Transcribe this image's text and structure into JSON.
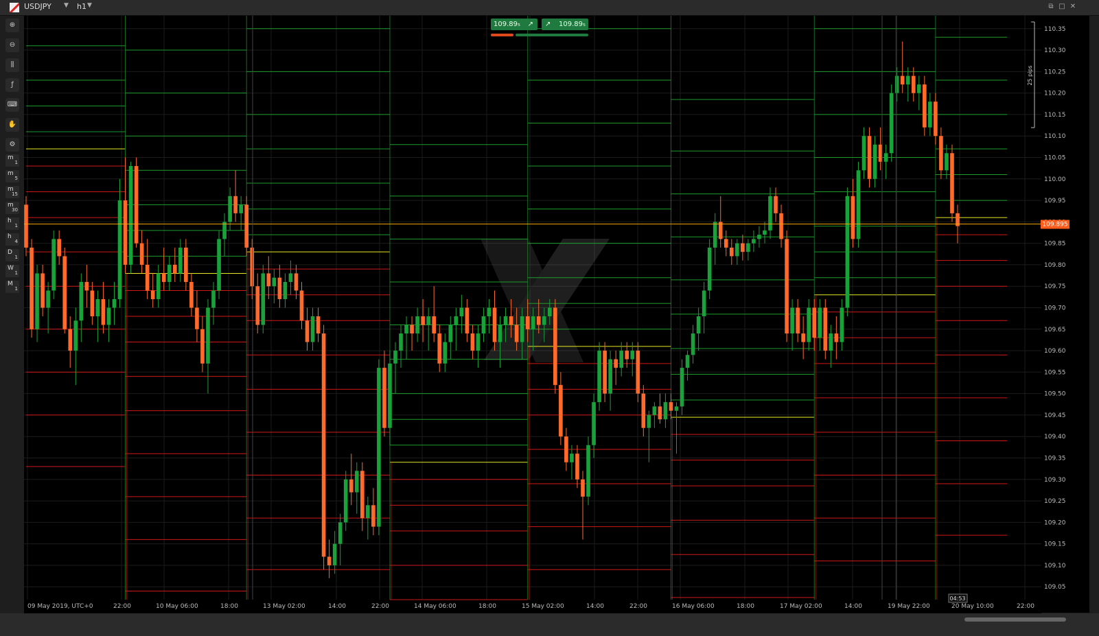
{
  "window": {
    "symbol": "USDJPY",
    "timeframe": "h1"
  },
  "toolbar": {
    "tools": [
      "zoom-in-icon",
      "zoom-out-icon",
      "candles-icon",
      "indicator-icon",
      "controller-icon",
      "hand-icon",
      "settings-icon"
    ],
    "timeframes": [
      {
        "a": "m",
        "b": "1"
      },
      {
        "a": "m",
        "b": "5"
      },
      {
        "a": "m",
        "b": "15"
      },
      {
        "a": "m",
        "b": "30"
      },
      {
        "a": "h",
        "b": "1"
      },
      {
        "a": "h",
        "b": "4"
      },
      {
        "a": "D",
        "b": "1"
      },
      {
        "a": "W",
        "b": "1"
      },
      {
        "a": "M",
        "b": "1"
      }
    ]
  },
  "quick_trade": {
    "sell": "109.89₅",
    "buy": "109.89₅"
  },
  "price_tag": "109.895",
  "pips_label": "25 pips",
  "countdown": "04:53",
  "colors": {
    "bull": "#1aa23a",
    "bear": "#ff6a2b",
    "green_level": "#1d9c2c",
    "red_level": "#d01818",
    "pivot": "#e8e820",
    "price": "#f0a500"
  },
  "chart_data": {
    "type": "candlestick",
    "ylim": [
      109.02,
      110.38
    ],
    "y_ticks": [
      "110.35",
      "110.30",
      "110.25",
      "110.20",
      "110.15",
      "110.10",
      "110.05",
      "110.00",
      "109.95",
      "109.90",
      "109.85",
      "109.80",
      "109.75",
      "109.70",
      "109.65",
      "109.60",
      "109.55",
      "109.50",
      "109.45",
      "109.40",
      "109.35",
      "109.30",
      "109.25",
      "109.20",
      "109.15",
      "109.10",
      "109.05"
    ],
    "x_labels": [
      "09 May 2019, UTC+0",
      "22:00",
      "10 May 06:00",
      "18:00",
      "13 May 02:00",
      "14:00",
      "22:00",
      "14 May 06:00",
      "18:00",
      "15 May 02:00",
      "14:00",
      "22:00",
      "16 May 06:00",
      "18:00",
      "17 May 02:00",
      "14:00",
      "19 May 22:00",
      "20 May 10:00",
      "22:00"
    ],
    "current_price": 109.895,
    "pivots": [
      {
        "from": 0,
        "to": 18,
        "p": 110.07
      },
      {
        "from": 18,
        "to": 40,
        "p": 109.78
      },
      {
        "from": 40,
        "to": 66,
        "p": 109.83
      },
      {
        "from": 66,
        "to": 91,
        "p": 109.34
      },
      {
        "from": 91,
        "to": 117,
        "p": 109.61
      },
      {
        "from": 117,
        "to": 143,
        "p": 109.445
      },
      {
        "from": 143,
        "to": 165,
        "p": 109.73
      },
      {
        "from": 165,
        "to": 178,
        "p": 109.91
      }
    ],
    "candles": [
      [
        109.94,
        109.96,
        109.82,
        109.84
      ],
      [
        109.84,
        109.86,
        109.63,
        109.65
      ],
      [
        109.65,
        109.8,
        109.62,
        109.78
      ],
      [
        109.78,
        109.8,
        109.68,
        109.7
      ],
      [
        109.7,
        109.76,
        109.64,
        109.74
      ],
      [
        109.74,
        109.88,
        109.72,
        109.86
      ],
      [
        109.86,
        109.88,
        109.8,
        109.82
      ],
      [
        109.82,
        109.84,
        109.64,
        109.65
      ],
      [
        109.65,
        109.68,
        109.56,
        109.6
      ],
      [
        109.6,
        109.7,
        109.52,
        109.67
      ],
      [
        109.67,
        109.78,
        109.62,
        109.76
      ],
      [
        109.76,
        109.8,
        109.7,
        109.74
      ],
      [
        109.74,
        109.76,
        109.66,
        109.68
      ],
      [
        109.68,
        109.74,
        109.62,
        109.72
      ],
      [
        109.72,
        109.76,
        109.64,
        109.66
      ],
      [
        109.66,
        109.72,
        109.62,
        109.7
      ],
      [
        109.7,
        109.76,
        109.66,
        109.72
      ],
      [
        109.72,
        110.0,
        109.7,
        109.95
      ],
      [
        109.95,
        110.05,
        109.78,
        109.8
      ],
      [
        109.8,
        110.04,
        109.78,
        110.03
      ],
      [
        110.03,
        110.05,
        109.84,
        109.85
      ],
      [
        109.85,
        109.88,
        109.78,
        109.8
      ],
      [
        109.8,
        109.86,
        109.72,
        109.74
      ],
      [
        109.74,
        109.78,
        109.7,
        109.72
      ],
      [
        109.72,
        109.8,
        109.7,
        109.78
      ],
      [
        109.78,
        109.84,
        109.74,
        109.76
      ],
      [
        109.76,
        109.82,
        109.74,
        109.8
      ],
      [
        109.8,
        109.84,
        109.76,
        109.78
      ],
      [
        109.78,
        109.86,
        109.76,
        109.84
      ],
      [
        109.84,
        109.86,
        109.74,
        109.76
      ],
      [
        109.76,
        109.78,
        109.68,
        109.7
      ],
      [
        109.7,
        109.74,
        109.62,
        109.65
      ],
      [
        109.65,
        109.68,
        109.55,
        109.57
      ],
      [
        109.57,
        109.72,
        109.5,
        109.7
      ],
      [
        109.7,
        109.76,
        109.66,
        109.74
      ],
      [
        109.74,
        109.88,
        109.72,
        109.86
      ],
      [
        109.86,
        109.92,
        109.82,
        109.9
      ],
      [
        109.9,
        109.98,
        109.88,
        109.96
      ],
      [
        109.96,
        110.02,
        109.9,
        109.92
      ],
      [
        109.92,
        109.96,
        109.88,
        109.94
      ],
      [
        109.94,
        109.96,
        109.82,
        109.84
      ],
      [
        109.84,
        109.86,
        109.72,
        109.75
      ],
      [
        109.75,
        109.78,
        109.64,
        109.66
      ],
      [
        109.66,
        109.8,
        109.64,
        109.78
      ],
      [
        109.78,
        109.82,
        109.72,
        109.75
      ],
      [
        109.75,
        109.79,
        109.71,
        109.77
      ],
      [
        109.77,
        109.8,
        109.7,
        109.72
      ],
      [
        109.72,
        109.78,
        109.7,
        109.76
      ],
      [
        109.76,
        109.81,
        109.73,
        109.78
      ],
      [
        109.78,
        109.8,
        109.72,
        109.74
      ],
      [
        109.74,
        109.76,
        109.65,
        109.67
      ],
      [
        109.67,
        109.7,
        109.6,
        109.62
      ],
      [
        109.62,
        109.7,
        109.6,
        109.68
      ],
      [
        109.68,
        109.7,
        109.62,
        109.64
      ],
      [
        109.64,
        109.66,
        109.09,
        109.12
      ],
      [
        109.12,
        109.16,
        109.07,
        109.1
      ],
      [
        109.1,
        109.18,
        109.08,
        109.15
      ],
      [
        109.15,
        109.22,
        109.1,
        109.2
      ],
      [
        109.2,
        109.32,
        109.18,
        109.3
      ],
      [
        109.3,
        109.36,
        109.24,
        109.27
      ],
      [
        109.27,
        109.34,
        109.22,
        109.32
      ],
      [
        109.32,
        109.34,
        109.18,
        109.21
      ],
      [
        109.21,
        109.26,
        109.16,
        109.24
      ],
      [
        109.24,
        109.28,
        109.17,
        109.19
      ],
      [
        109.19,
        109.58,
        109.17,
        109.56
      ],
      [
        109.56,
        109.6,
        109.4,
        109.42
      ],
      [
        109.42,
        109.6,
        109.38,
        109.57
      ],
      [
        109.57,
        109.62,
        109.5,
        109.6
      ],
      [
        109.6,
        109.66,
        109.56,
        109.64
      ],
      [
        109.64,
        109.68,
        109.58,
        109.66
      ],
      [
        109.66,
        109.68,
        109.6,
        109.64
      ],
      [
        109.64,
        109.7,
        109.62,
        109.68
      ],
      [
        109.68,
        109.72,
        109.62,
        109.66
      ],
      [
        109.66,
        109.7,
        109.6,
        109.68
      ],
      [
        109.68,
        109.75,
        109.62,
        109.64
      ],
      [
        109.64,
        109.66,
        109.55,
        109.57
      ],
      [
        109.57,
        109.64,
        109.55,
        109.62
      ],
      [
        109.62,
        109.68,
        109.58,
        109.66
      ],
      [
        109.66,
        109.7,
        109.6,
        109.68
      ],
      [
        109.68,
        109.73,
        109.64,
        109.7
      ],
      [
        109.7,
        109.72,
        109.62,
        109.64
      ],
      [
        109.64,
        109.66,
        109.58,
        109.6
      ],
      [
        109.6,
        109.66,
        109.56,
        109.64
      ],
      [
        109.64,
        109.7,
        109.62,
        109.68
      ],
      [
        109.68,
        109.72,
        109.64,
        109.7
      ],
      [
        109.7,
        109.74,
        109.6,
        109.62
      ],
      [
        109.62,
        109.68,
        109.56,
        109.66
      ],
      [
        109.66,
        109.7,
        109.62,
        109.68
      ],
      [
        109.68,
        109.72,
        109.63,
        109.66
      ],
      [
        109.66,
        109.7,
        109.6,
        109.62
      ],
      [
        109.62,
        109.7,
        109.58,
        109.68
      ],
      [
        109.68,
        109.72,
        109.62,
        109.65
      ],
      [
        109.65,
        109.7,
        109.6,
        109.68
      ],
      [
        109.68,
        109.72,
        109.64,
        109.66
      ],
      [
        109.66,
        109.7,
        109.62,
        109.68
      ],
      [
        109.68,
        109.72,
        109.66,
        109.7
      ],
      [
        109.7,
        109.72,
        109.5,
        109.52
      ],
      [
        109.52,
        109.55,
        109.38,
        109.4
      ],
      [
        109.4,
        109.42,
        109.32,
        109.34
      ],
      [
        109.34,
        109.38,
        109.3,
        109.36
      ],
      [
        109.36,
        109.38,
        109.28,
        109.3
      ],
      [
        109.3,
        109.32,
        109.16,
        109.26
      ],
      [
        109.26,
        109.4,
        109.24,
        109.38
      ],
      [
        109.38,
        109.5,
        109.35,
        109.48
      ],
      [
        109.48,
        109.62,
        109.46,
        109.6
      ],
      [
        109.6,
        109.62,
        109.48,
        109.5
      ],
      [
        109.5,
        109.6,
        109.46,
        109.58
      ],
      [
        109.58,
        109.6,
        109.52,
        109.56
      ],
      [
        109.56,
        109.62,
        109.54,
        109.6
      ],
      [
        109.6,
        109.62,
        109.56,
        109.58
      ],
      [
        109.58,
        109.62,
        109.54,
        109.6
      ],
      [
        109.6,
        109.62,
        109.48,
        109.5
      ],
      [
        109.5,
        109.52,
        109.4,
        109.42
      ],
      [
        109.42,
        109.46,
        109.34,
        109.45
      ],
      [
        109.45,
        109.48,
        109.42,
        109.47
      ],
      [
        109.47,
        109.5,
        109.43,
        109.44
      ],
      [
        109.44,
        109.5,
        109.42,
        109.48
      ],
      [
        109.48,
        109.5,
        109.44,
        109.46
      ],
      [
        109.46,
        109.48,
        109.36,
        109.47
      ],
      [
        109.47,
        109.58,
        109.45,
        109.56
      ],
      [
        109.56,
        109.6,
        109.53,
        109.59
      ],
      [
        109.59,
        109.66,
        109.57,
        109.64
      ],
      [
        109.64,
        109.7,
        109.6,
        109.68
      ],
      [
        109.68,
        109.76,
        109.64,
        109.74
      ],
      [
        109.74,
        109.86,
        109.72,
        109.84
      ],
      [
        109.84,
        109.92,
        109.8,
        109.9
      ],
      [
        109.9,
        109.96,
        109.84,
        109.86
      ],
      [
        109.86,
        109.88,
        109.82,
        109.84
      ],
      [
        109.84,
        109.86,
        109.8,
        109.82
      ],
      [
        109.82,
        109.86,
        109.8,
        109.85
      ],
      [
        109.85,
        109.87,
        109.81,
        109.83
      ],
      [
        109.83,
        109.86,
        109.81,
        109.85
      ],
      [
        109.85,
        109.88,
        109.83,
        109.86
      ],
      [
        109.86,
        109.89,
        109.84,
        109.87
      ],
      [
        109.87,
        109.9,
        109.85,
        109.88
      ],
      [
        109.88,
        109.98,
        109.86,
        109.96
      ],
      [
        109.96,
        109.98,
        109.9,
        109.92
      ],
      [
        109.92,
        109.94,
        109.84,
        109.86
      ],
      [
        109.86,
        109.88,
        109.62,
        109.64
      ],
      [
        109.64,
        109.72,
        109.6,
        109.7
      ],
      [
        109.7,
        109.72,
        109.62,
        109.64
      ],
      [
        109.64,
        109.68,
        109.58,
        109.62
      ],
      [
        109.62,
        109.72,
        109.6,
        109.7
      ],
      [
        109.7,
        109.72,
        109.6,
        109.63
      ],
      [
        109.63,
        109.72,
        109.6,
        109.7
      ],
      [
        109.7,
        109.72,
        109.58,
        109.6
      ],
      [
        109.6,
        109.66,
        109.56,
        109.64
      ],
      [
        109.64,
        109.68,
        109.58,
        109.62
      ],
      [
        109.62,
        109.72,
        109.6,
        109.7
      ],
      [
        109.7,
        109.98,
        109.68,
        109.96
      ],
      [
        109.96,
        110.0,
        109.84,
        109.86
      ],
      [
        109.86,
        110.04,
        109.84,
        110.02
      ],
      [
        110.02,
        110.12,
        110.0,
        110.1
      ],
      [
        110.1,
        110.12,
        109.98,
        110.0
      ],
      [
        110.0,
        110.1,
        109.98,
        110.08
      ],
      [
        110.08,
        110.12,
        110.02,
        110.04
      ],
      [
        110.04,
        110.08,
        110.0,
        110.06
      ],
      [
        110.06,
        110.22,
        110.04,
        110.2
      ],
      [
        110.2,
        110.26,
        110.18,
        110.24
      ],
      [
        110.24,
        110.32,
        110.2,
        110.22
      ],
      [
        110.22,
        110.26,
        110.18,
        110.24
      ],
      [
        110.24,
        110.26,
        110.18,
        110.2
      ],
      [
        110.2,
        110.24,
        110.16,
        110.22
      ],
      [
        110.22,
        110.24,
        110.1,
        110.12
      ],
      [
        110.12,
        110.2,
        110.1,
        110.18
      ],
      [
        110.18,
        110.2,
        110.08,
        110.1
      ],
      [
        110.1,
        110.12,
        110.0,
        110.02
      ],
      [
        110.02,
        110.08,
        110.0,
        110.06
      ],
      [
        110.06,
        110.08,
        109.9,
        109.92
      ],
      [
        109.92,
        109.94,
        109.85,
        109.89
      ]
    ]
  }
}
